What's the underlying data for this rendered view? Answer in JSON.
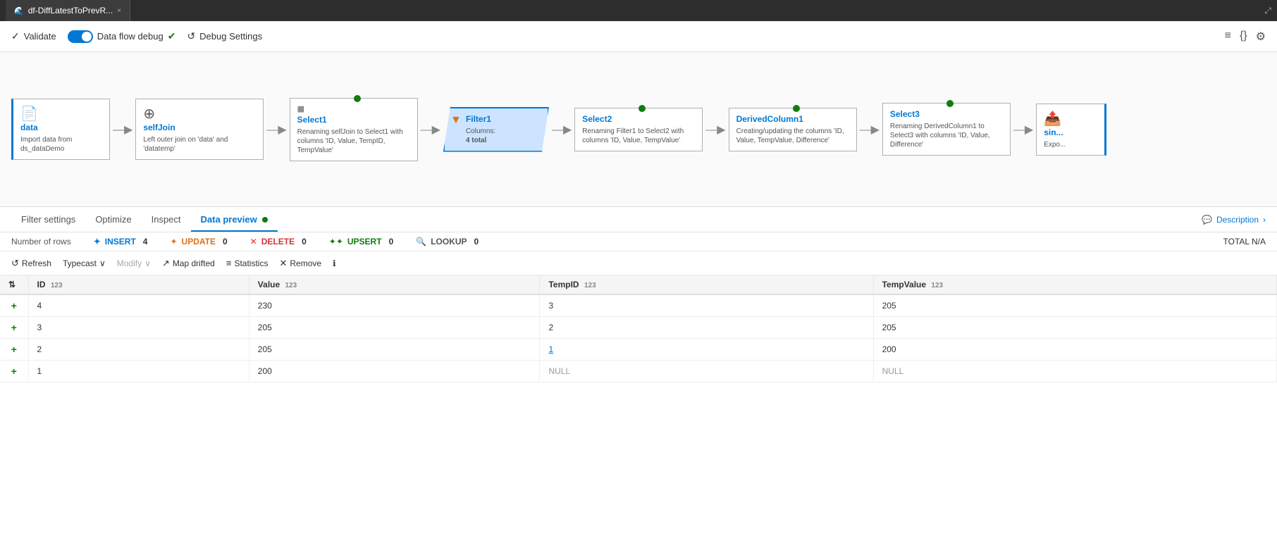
{
  "windowTab": {
    "title": "df-DiffLatestToPrevR...",
    "closeLabel": "×"
  },
  "toolbar": {
    "validateLabel": "Validate",
    "validateIcon": "✓",
    "debugLabel": "Data flow debug",
    "debugSettingsLabel": "Debug Settings",
    "debugSettingsIcon": "⚙",
    "rightIcons": [
      "≡",
      "{}",
      "⚙≡"
    ]
  },
  "canvas": {
    "nodes": [
      {
        "id": "data",
        "title": "data",
        "icon": "📄",
        "desc": "Import data from ds_dataDemo",
        "active": false,
        "isSource": true
      },
      {
        "id": "selfJoin",
        "title": "selfJoin",
        "icon": "⊕",
        "desc": "Left outer join on 'data' and 'datatemp'",
        "active": false
      },
      {
        "id": "Select1",
        "title": "Select1",
        "icon": "",
        "desc": "Renaming selfJoin to Select1 with columns 'ID, Value, TempID, TempValue'",
        "active": false
      },
      {
        "id": "Filter1",
        "title": "Filter1",
        "icon": "▼",
        "desc": "Columns: 4 total",
        "active": true
      },
      {
        "id": "Select2",
        "title": "Select2",
        "icon": "",
        "desc": "Renaming Filter1 to Select2 with columns 'ID, Value, TempValue'",
        "active": false
      },
      {
        "id": "DerivedColumn1",
        "title": "DerivedColumn1",
        "icon": "",
        "desc": "Creating/updating the columns 'ID, Value, TempValue, Difference'",
        "active": false
      },
      {
        "id": "Select3",
        "title": "Select3",
        "icon": "",
        "desc": "Renaming DerivedColumn1 to Select3 with columns 'ID, Value, Difference'",
        "active": false
      },
      {
        "id": "sink",
        "title": "sin...",
        "icon": "📤",
        "desc": "Expo...",
        "active": false,
        "isSink": true
      }
    ]
  },
  "subTabs": [
    {
      "id": "filter-settings",
      "label": "Filter settings",
      "active": false
    },
    {
      "id": "optimize",
      "label": "Optimize",
      "active": false
    },
    {
      "id": "inspect",
      "label": "Inspect",
      "active": false
    },
    {
      "id": "data-preview",
      "label": "Data preview",
      "active": true
    }
  ],
  "descriptionLink": "Description",
  "stats": {
    "rowsLabel": "Number of rows",
    "insertLabel": "INSERT",
    "insertValue": "4",
    "updateLabel": "UPDATE",
    "updateValue": "0",
    "deleteLabel": "DELETE",
    "deleteValue": "0",
    "upsertLabel": "UPSERT",
    "upsertValue": "0",
    "lookupLabel": "LOOKUP",
    "lookupValue": "0",
    "totalLabel": "TOTAL",
    "totalValue": "N/A"
  },
  "dataToolbar": {
    "refreshLabel": "Refresh",
    "typeCastLabel": "Typecast",
    "modifyLabel": "Modify",
    "mapDriftedLabel": "Map drifted",
    "statisticsLabel": "Statistics",
    "removeLabel": "Remove"
  },
  "table": {
    "columns": [
      {
        "name": "ID",
        "type": "123"
      },
      {
        "name": "Value",
        "type": "123"
      },
      {
        "name": "TempID",
        "type": "123"
      },
      {
        "name": "TempValue",
        "type": "123"
      }
    ],
    "rows": [
      {
        "insertIcon": "+",
        "id": "4",
        "value": "230",
        "tempId": "3",
        "tempValue": "205",
        "tempIdLink": false
      },
      {
        "insertIcon": "+",
        "id": "3",
        "value": "205",
        "tempId": "2",
        "tempValue": "205",
        "tempIdLink": false
      },
      {
        "insertIcon": "+",
        "id": "2",
        "value": "205",
        "tempId": "1",
        "tempValue": "200",
        "tempIdLink": true
      },
      {
        "insertIcon": "+",
        "id": "1",
        "value": "200",
        "tempId": "NULL",
        "tempValue": "NULL",
        "tempIdLink": false
      }
    ]
  }
}
